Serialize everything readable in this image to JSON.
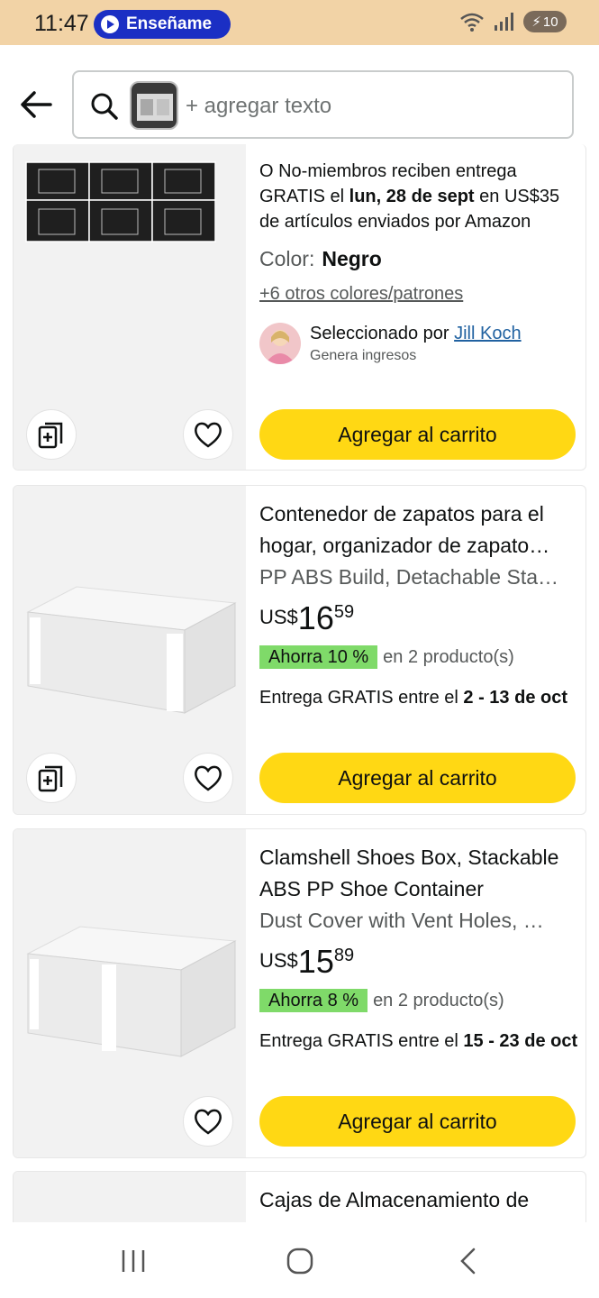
{
  "status_bar": {
    "time": "11:47",
    "assistant_label": "Enseñame",
    "wifi_label": "5",
    "battery": "10",
    "icons": [
      "play-icon",
      "wifi-icon",
      "signal-icon",
      "battery-icon"
    ]
  },
  "header": {
    "search_placeholder": "+ agregar texto",
    "icons": [
      "back-arrow-icon",
      "search-icon",
      "image-thumbnail"
    ]
  },
  "products": [
    {
      "delivery_prefix": "O No-miembros reciben entrega GRATIS el ",
      "delivery_date": "lun, 28 de sept",
      "delivery_suffix": " en US$35 de artículos enviados por Amazon",
      "color_label": "Color:",
      "color_value": "Negro",
      "more_colors": "+6 otros colores/patrones",
      "picked_by_prefix": "Seleccionado por ",
      "picked_by_name": "Jill Koch",
      "picked_by_note": "Genera ingresos",
      "add_to_cart": "Agregar al carrito"
    },
    {
      "title": "Contenedor de zapatos para el hogar, organizador de zapato…",
      "subtitle": "PP ABS Build, Detachable Sta…",
      "price_currency": "US$",
      "price_whole": "16",
      "price_fraction": "59",
      "deal_badge": "Ahorra 10 %",
      "deal_text": "en 2 producto(s)",
      "delivery_prefix": "Entrega GRATIS entre el ",
      "delivery_date": "2 - 13 de oct",
      "add_to_cart": "Agregar al carrito"
    },
    {
      "title": "Clamshell Shoes Box, Stackable ABS PP Shoe Container",
      "subtitle": "Dust Cover with Vent Holes, …",
      "price_currency": "US$",
      "price_whole": "15",
      "price_fraction": "89",
      "deal_badge": "Ahorra 8 %",
      "deal_text": "en 2 producto(s)",
      "delivery_prefix": "Entrega GRATIS entre el ",
      "delivery_date": "15 - 23 de oct",
      "add_to_cart": "Agregar al carrito"
    },
    {
      "title": "Cajas de Almacenamiento de"
    }
  ],
  "nav": {
    "icons": [
      "recent-apps-icon",
      "home-icon",
      "back-icon"
    ]
  },
  "colors": {
    "status_bar_bg": "#f2d3a6",
    "pill_bg": "#1b2fc4",
    "cart_button": "#ffd814",
    "deal_badge": "#7fda69",
    "link": "#2162a1"
  }
}
